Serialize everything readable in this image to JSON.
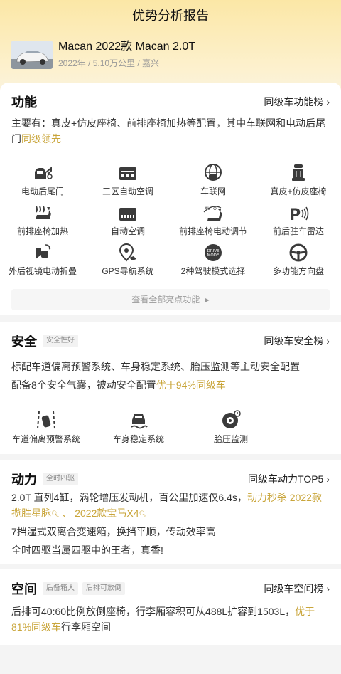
{
  "header": {
    "title": "优势分析报告"
  },
  "car": {
    "title": "Macan 2022款 Macan 2.0T",
    "subtitle": "2022年 / 5.10万公里 / 嘉兴"
  },
  "function": {
    "title": "功能",
    "link": "同级车功能榜",
    "desc_plain": "主要有：真皮+仿皮座椅、前排座椅加热等配置，其中车联网和电动后尾门",
    "desc_highlight": "同级领先",
    "items": [
      {
        "label": "电动后尾门",
        "icon": "trunk-icon"
      },
      {
        "label": "三区自动空调",
        "icon": "ac-icon"
      },
      {
        "label": "车联网",
        "icon": "globe-car-icon"
      },
      {
        "label": "真皮+仿皮座椅",
        "icon": "leather-seat-icon"
      },
      {
        "label": "前排座椅加热",
        "icon": "seat-heat-icon"
      },
      {
        "label": "自动空调",
        "icon": "auto-ac-icon"
      },
      {
        "label": "前排座椅电动调节",
        "icon": "seat-auto-icon"
      },
      {
        "label": "前后驻车雷达",
        "icon": "parking-radar-icon"
      },
      {
        "label": "外后视镜电动折叠",
        "icon": "mirror-fold-icon"
      },
      {
        "label": "GPS导航系统",
        "icon": "gps-icon"
      },
      {
        "label": "2种驾驶模式选择",
        "icon": "drive-mode-icon"
      },
      {
        "label": "多功能方向盘",
        "icon": "steering-wheel-icon"
      }
    ],
    "icon_text": {
      "auto": "AUTO",
      "drive": "DRIVE",
      "mode": "MODE",
      "p": "P"
    },
    "more_label": "查看全部亮点功能"
  },
  "safety": {
    "title": "安全",
    "tag": "安全性好",
    "link": "同级车安全榜",
    "line1": "标配车道偏离预警系统、车身稳定系统、胎压监测等主动安全配置",
    "line2_plain": "配备8个安全气囊，被动安全配置",
    "line2_highlight": "优于94%同级车",
    "items": [
      {
        "label": "车道偏离预警系统",
        "icon": "lane-warning-icon"
      },
      {
        "label": "车身稳定系统",
        "icon": "stability-icon"
      },
      {
        "label": "胎压监测",
        "icon": "tire-pressure-icon"
      }
    ]
  },
  "power": {
    "title": "动力",
    "tag": "全时四驱",
    "link": "同级车动力TOP5",
    "line1_plain": "2.0T 直列4缸，涡轮增压发动机，百公里加速仅6.4s，",
    "line1_hl1": "动力秒杀 2022款揽胜星脉",
    "line1_sep": " 、 ",
    "line1_hl2": "2022款宝马X4",
    "line2": "7挡湿式双离合变速箱，换挡平顺，传动效率高",
    "line3": "全时四驱当属四驱中的王者，真香!"
  },
  "space": {
    "title": "空间",
    "tag1": "后备箱大",
    "tag2": "后排可放倒",
    "link": "同级车空间榜",
    "line_plain": "后排可40:60比例放倒座椅，行李厢容积可从488L扩容到1503L，",
    "line_highlight": "优于81%同级车",
    "line_tail": "行李厢空间"
  },
  "colors": {
    "accent": "#c9a53a",
    "header_bg": "#fbe7a6",
    "icon_dark": "#3b3b3b"
  }
}
